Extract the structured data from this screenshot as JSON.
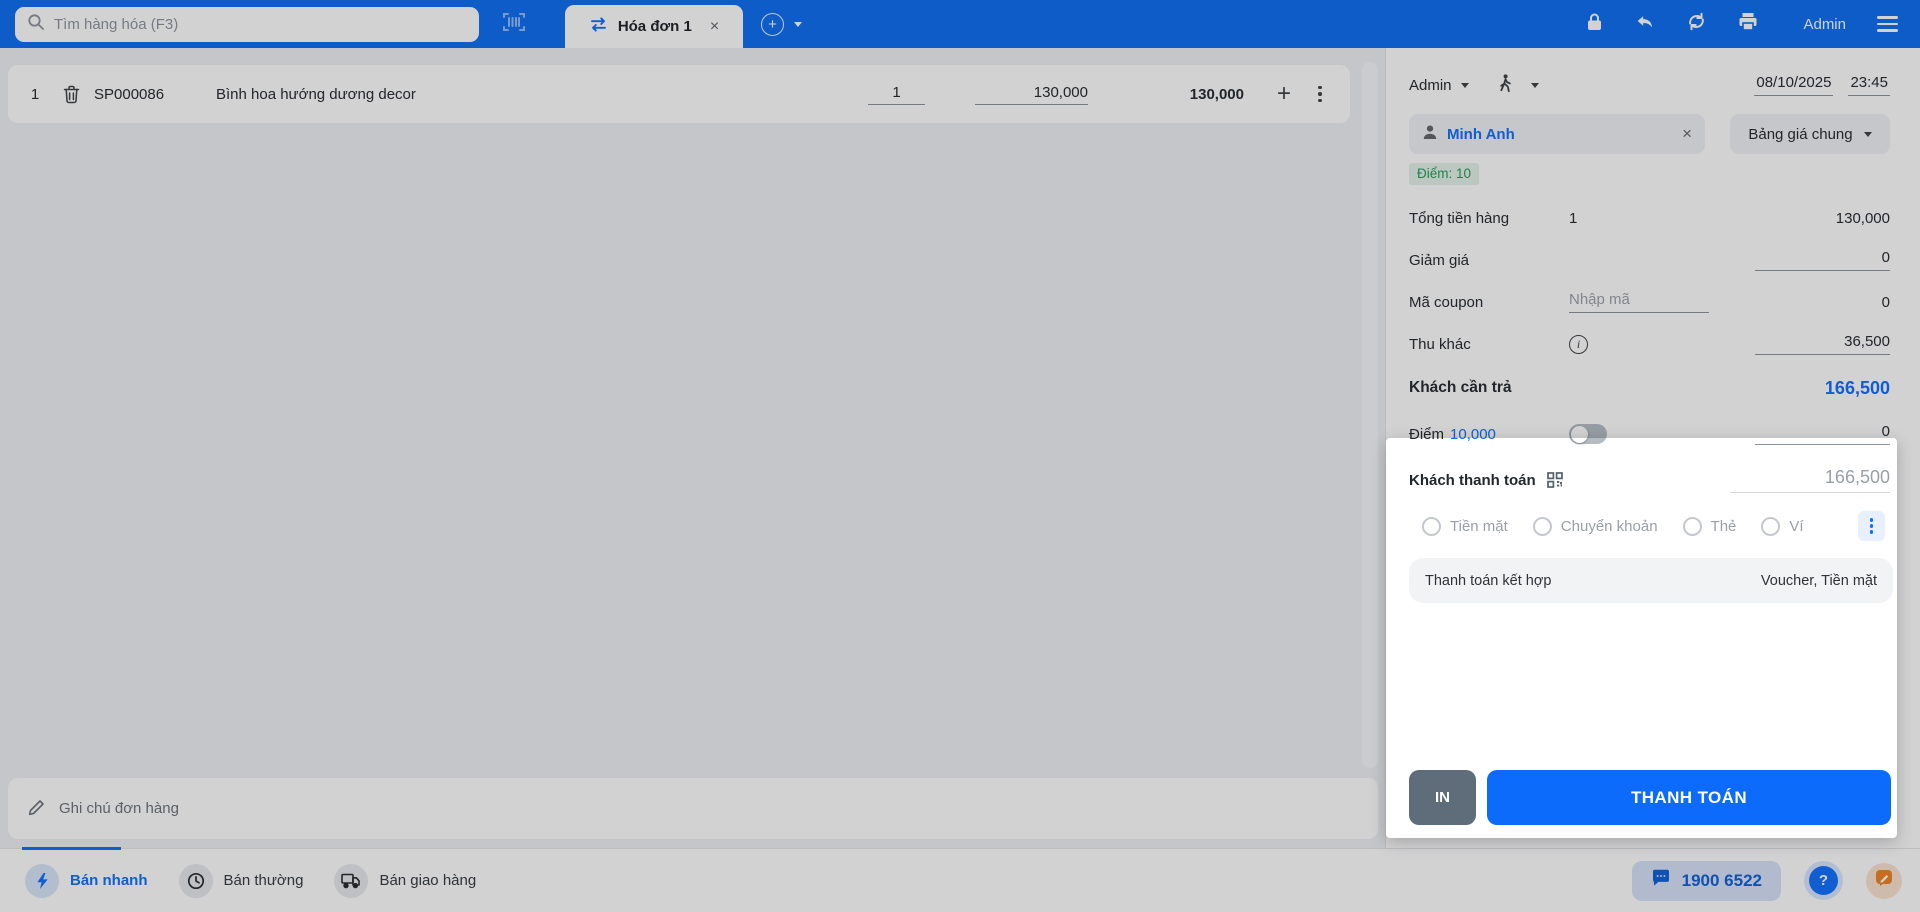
{
  "colors": {
    "brand_blue": "#0a6cf0",
    "accent_blue": "#0d6efd",
    "pay_button": "#0d6bfb",
    "print_button": "#5f6c79",
    "points_green": "#1d9e55",
    "points_green_bg": "#e3f2e8"
  },
  "icons": {
    "close": "×",
    "plus": "+",
    "info": "i",
    "question": "?"
  },
  "topbar": {
    "search_placeholder": "Tìm hàng hóa (F3)",
    "tab_label": "Hóa đơn 1",
    "user_label": "Admin"
  },
  "cart": {
    "rows": [
      {
        "index": "1",
        "code": "SP000086",
        "name": "Bình hoa hướng dương decor",
        "qty": "1",
        "price": "130,000",
        "total": "130,000"
      }
    ]
  },
  "note": {
    "placeholder": "Ghi chú đơn hàng"
  },
  "sidebar": {
    "seller": "Admin",
    "date": "08/10/2025",
    "time": "23:45",
    "customer": "Minh Anh",
    "price_book": "Bảng giá chung",
    "points_badge": "Điểm: 10",
    "rows": {
      "total_label": "Tổng tiền hàng",
      "total_qty": "1",
      "total_value": "130,000",
      "discount_label": "Giảm giá",
      "discount_value": "0",
      "coupon_label": "Mã coupon",
      "coupon_placeholder": "Nhập mã",
      "coupon_value": "0",
      "other_label": "Thu khác",
      "other_value": "36,500",
      "due_label": "Khách cần trả",
      "due_value": "166,500",
      "points_label": "Điểm",
      "points_value": "10,000",
      "points_input": "0",
      "paid_label": "Khách thanh toán",
      "paid_value": "166,500"
    },
    "payment_methods": [
      "Tiền mặt",
      "Chuyển khoản",
      "Thẻ",
      "Ví"
    ],
    "combined": {
      "label": "Thanh toán kết hợp",
      "value": "Voucher, Tiền mặt"
    },
    "buttons": {
      "print": "IN",
      "pay": "THANH TOÁN"
    }
  },
  "bottombar": {
    "tabs": [
      "Bán nhanh",
      "Bán thường",
      "Bán giao hàng"
    ],
    "hotline": "1900 6522"
  }
}
